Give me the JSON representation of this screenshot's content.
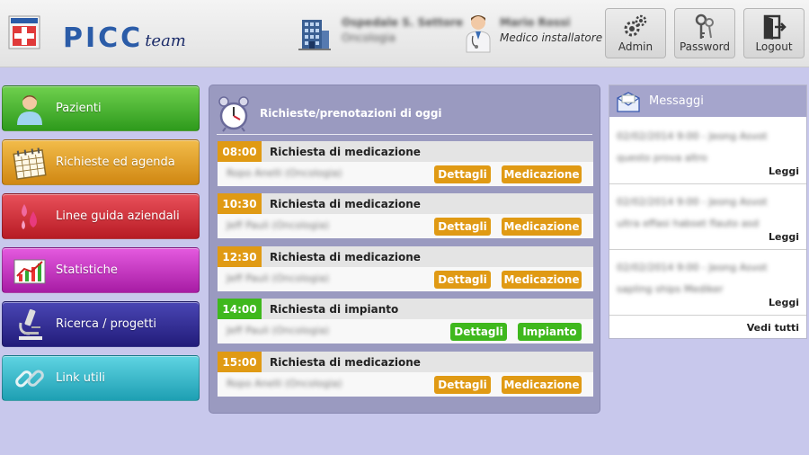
{
  "header": {
    "logo": {
      "main": "PICC",
      "suffix": "team"
    },
    "hospital": {
      "line1": "Ospedale S. Settore",
      "line2": "Oncologia"
    },
    "user": {
      "name": "Mario Rossi",
      "role": "Medico installatore"
    },
    "buttons": [
      {
        "label": "Admin",
        "icon": "gears-icon"
      },
      {
        "label": "Password",
        "icon": "keys-icon"
      },
      {
        "label": "Logout",
        "icon": "logout-door-icon"
      }
    ]
  },
  "menu": [
    {
      "label": "Pazienti",
      "icon": "patient-icon",
      "color": "#3fb81d"
    },
    {
      "label": "Richieste ed agenda",
      "icon": "calendar-icon",
      "color": "#e09a14"
    },
    {
      "label": "Linee guida aziendali",
      "icon": "drops-icon",
      "color": "#c9212c"
    },
    {
      "label": "Statistiche",
      "icon": "chart-icon",
      "color": "#c12ec0"
    },
    {
      "label": "Ricerca / progetti",
      "icon": "microscope-icon",
      "color": "#2d2890"
    },
    {
      "label": "Link utili",
      "icon": "link-icon",
      "color": "#2db6c8"
    }
  ],
  "requests": {
    "title": "Richieste/prenotazioni di oggi",
    "items": [
      {
        "time": "08:00",
        "title": "Richiesta di medicazione",
        "patient": "Ropo Anelli (Oncologia)",
        "details": "Dettagli",
        "action": "Medicazione",
        "color": "#e09a14"
      },
      {
        "time": "10:30",
        "title": "Richiesta di medicazione",
        "patient": "Jeff Pauli (Oncologia)",
        "details": "Dettagli",
        "action": "Medicazione",
        "color": "#e09a14"
      },
      {
        "time": "12:30",
        "title": "Richiesta di medicazione",
        "patient": "Jeff Pauli (Oncologia)",
        "details": "Dettagli",
        "action": "Medicazione",
        "color": "#e09a14"
      },
      {
        "time": "14:00",
        "title": "Richiesta di impianto",
        "patient": "Jeff Pauli (Oncologia)",
        "details": "Dettagli",
        "action": "Impianto",
        "color": "#3fb81d"
      },
      {
        "time": "15:00",
        "title": "Richiesta di medicazione",
        "patient": "Ropo Anelli (Oncologia)",
        "details": "Dettagli",
        "action": "Medicazione",
        "color": "#e09a14"
      }
    ]
  },
  "messages": {
    "title": "Messaggi",
    "items": [
      {
        "line1": "02/02/2014 9:00 - Jeong Asvot",
        "line2": "questo prova altro",
        "read": "Leggi"
      },
      {
        "line1": "02/02/2014 9:00 - Jeong Asvot",
        "line2": "ultra effasi habset flauto asd",
        "read": "Leggi"
      },
      {
        "line1": "02/02/2014 9:00 - Jeong Asvot",
        "line2": "sapling ships Mediker",
        "read": "Leggi"
      }
    ],
    "view_all": "Vedi tutti"
  }
}
